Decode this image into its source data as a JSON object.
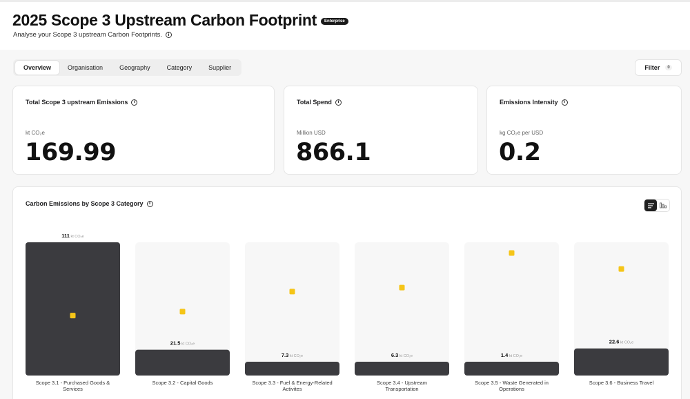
{
  "header": {
    "title": "2025 Scope 3 Upstream Carbon Footprint",
    "badge": "Enterprise",
    "subtitle": "Analyse your Scope 3 upstream Carbon Footprints."
  },
  "tabs": [
    {
      "label": "Overview",
      "active": true
    },
    {
      "label": "Organisation",
      "active": false
    },
    {
      "label": "Geography",
      "active": false
    },
    {
      "label": "Category",
      "active": false
    },
    {
      "label": "Supplier",
      "active": false
    }
  ],
  "filter": {
    "label": "Filter",
    "count": "0"
  },
  "cards": [
    {
      "title": "Total Scope 3 upstream Emissions",
      "unit": "kt CO₂e",
      "value": "169.99"
    },
    {
      "title": "Total Spend",
      "unit": "Million USD",
      "value": "866.1"
    },
    {
      "title": "Emissions Intensity",
      "unit": "kg CO₂e per USD",
      "value": "0.2"
    }
  ],
  "chart": {
    "title": "Carbon Emissions by Scope 3 Category"
  },
  "colors": {
    "bar": "#3b3b3f",
    "bar_track": "#f7f7f7",
    "marker": "#f5c518",
    "accent_dark": "#1f1f1f"
  },
  "icons": {
    "info": "info-icon",
    "list_view": "list-view-icon",
    "chart_view": "bar-chart-icon"
  },
  "chart_data": {
    "type": "bar",
    "categories": [
      "Scope 3.1 - Purchased Goods & Services",
      "Scope 3.2 - Capital Goods",
      "Scope 3.3 - Fuel & Energy-Related Activites",
      "Scope 3.4 - Upstream Transportation",
      "Scope 3.5 - Waste Generated in Operations",
      "Scope 3.6 - Business Travel"
    ],
    "values": [
      111,
      21.5,
      7.3,
      6.3,
      1.4,
      22.6
    ],
    "value_labels": [
      "111",
      "21.5",
      "7.3",
      "6.3",
      "1.4",
      "22.6"
    ],
    "value_unit": "kt CO₂e",
    "markers": [
      45,
      48,
      63,
      66,
      92,
      80
    ],
    "ylim": [
      0,
      111
    ],
    "grid": false,
    "legend": "none"
  }
}
